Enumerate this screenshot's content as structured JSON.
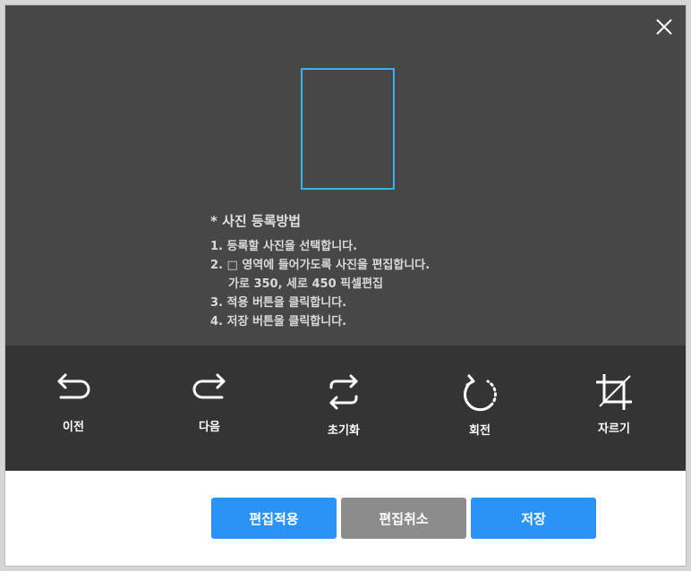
{
  "instructions": {
    "title": "* 사진 등록방법",
    "lines": [
      "1. 등록할 사진을 선택합니다.",
      "2. □ 영역에 들어가도록 사진을 편집합니다.",
      "가로 350, 세로 450 픽셀편집",
      "3. 적용 버튼을 클릭합니다.",
      "4. 저장 버튼을 클릭합니다."
    ]
  },
  "toolbar": {
    "undo_label": "이전",
    "redo_label": "다음",
    "reset_label": "초기화",
    "rotate_label": "회전",
    "crop_label": "자르기"
  },
  "footer": {
    "apply_label": "편집적용",
    "cancel_label": "편집취소",
    "save_label": "저장"
  },
  "colors": {
    "editor_bg": "#474747",
    "toolbar_bg": "#343434",
    "crop_frame": "#3ab2e8",
    "primary_button": "#2b93f3",
    "secondary_button": "#8c8c8c"
  },
  "icons": [
    "close-icon",
    "undo-icon",
    "redo-icon",
    "reset-icon",
    "rotate-icon",
    "crop-icon"
  ]
}
